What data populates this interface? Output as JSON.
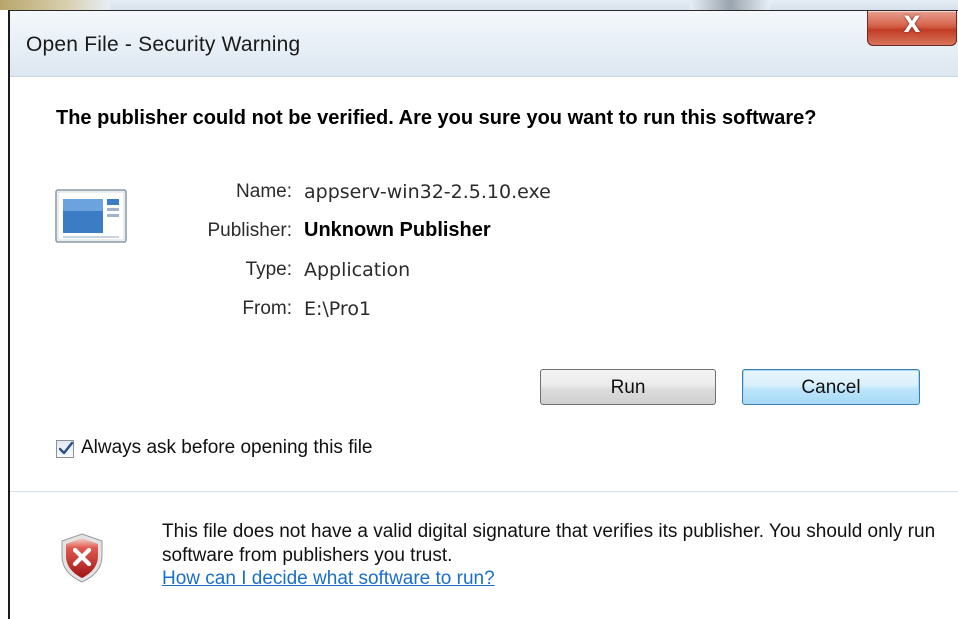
{
  "window": {
    "title": "Open File - Security Warning",
    "close_glyph": "X"
  },
  "warning": {
    "heading": "The publisher could not be verified.  Are you sure you want to run this software?"
  },
  "details": {
    "name_label": "Name:",
    "name_value": "appserv-win32-2.5.10.exe",
    "publisher_label": "Publisher:",
    "publisher_value": "Unknown Publisher",
    "type_label": "Type:",
    "type_value": "Application",
    "from_label": "From:",
    "from_value": "E:\\Pro1"
  },
  "buttons": {
    "run": "Run",
    "cancel": "Cancel"
  },
  "checkbox": {
    "label": "Always ask before opening this file",
    "checked": true
  },
  "footer": {
    "message": "This file does not have a valid digital signature that verifies its publisher.  You should only run software from publishers you trust.",
    "link": "How can I decide what software to run?"
  },
  "icons": {
    "app": "application-window-icon",
    "shield": "security-shield-error-icon",
    "close": "close-icon",
    "check": "checkmark-icon"
  },
  "colors": {
    "close_button": "#c23c24",
    "link": "#1a6fc9",
    "shield": "#c8282a"
  }
}
